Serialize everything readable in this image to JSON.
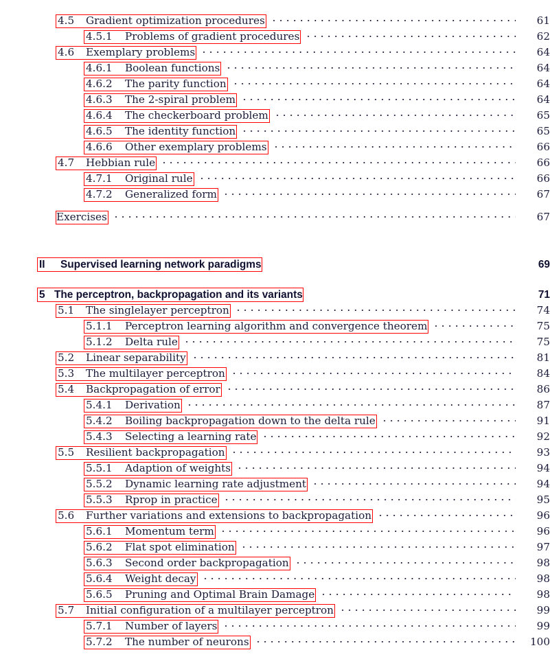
{
  "document": {
    "kind": "table-of-contents",
    "accent_color": "#ff0000",
    "text_color": "#1b1b3a"
  },
  "entries": [
    {
      "level": "section",
      "number": "4.5",
      "title": "Gradient optimization procedures",
      "page": "61"
    },
    {
      "level": "subsection",
      "number": "4.5.1",
      "title": "Problems of gradient procedures",
      "page": "62"
    },
    {
      "level": "section",
      "number": "4.6",
      "title": "Exemplary problems",
      "page": "64"
    },
    {
      "level": "subsection",
      "number": "4.6.1",
      "title": "Boolean functions",
      "page": "64"
    },
    {
      "level": "subsection",
      "number": "4.6.2",
      "title": "The parity function",
      "page": "64"
    },
    {
      "level": "subsection",
      "number": "4.6.3",
      "title": "The 2-spiral problem",
      "page": "64"
    },
    {
      "level": "subsection",
      "number": "4.6.4",
      "title": "The checkerboard problem",
      "page": "65"
    },
    {
      "level": "subsection",
      "number": "4.6.5",
      "title": "The identity function",
      "page": "65"
    },
    {
      "level": "subsection",
      "number": "4.6.6",
      "title": "Other exemplary problems",
      "page": "66"
    },
    {
      "level": "section",
      "number": "4.7",
      "title": "Hebbian rule",
      "page": "66"
    },
    {
      "level": "subsection",
      "number": "4.7.1",
      "title": "Original rule",
      "page": "66"
    },
    {
      "level": "subsection",
      "number": "4.7.2",
      "title": "Generalized form",
      "page": "67"
    },
    {
      "level": "plain",
      "number": "",
      "title": "Exercises",
      "page": "67"
    },
    {
      "level": "part",
      "number": "II",
      "title": "Supervised learning network paradigms",
      "page": "69"
    },
    {
      "level": "chapter",
      "number": "5",
      "title": "The perceptron, backpropagation and its variants",
      "page": "71"
    },
    {
      "level": "section",
      "number": "5.1",
      "title": "The singlelayer perceptron",
      "page": "74"
    },
    {
      "level": "subsection",
      "number": "5.1.1",
      "title": "Perceptron learning algorithm and convergence theorem",
      "page": "75"
    },
    {
      "level": "subsection",
      "number": "5.1.2",
      "title": "Delta rule",
      "page": "75"
    },
    {
      "level": "section",
      "number": "5.2",
      "title": "Linear separability",
      "page": "81"
    },
    {
      "level": "section",
      "number": "5.3",
      "title": "The multilayer perceptron",
      "page": "84"
    },
    {
      "level": "section",
      "number": "5.4",
      "title": "Backpropagation of error",
      "page": "86"
    },
    {
      "level": "subsection",
      "number": "5.4.1",
      "title": "Derivation",
      "page": "87"
    },
    {
      "level": "subsection",
      "number": "5.4.2",
      "title": "Boiling backpropagation down to the delta rule",
      "page": "91"
    },
    {
      "level": "subsection",
      "number": "5.4.3",
      "title": "Selecting a learning rate",
      "page": "92"
    },
    {
      "level": "section",
      "number": "5.5",
      "title": "Resilient backpropagation",
      "page": "93"
    },
    {
      "level": "subsection",
      "number": "5.5.1",
      "title": "Adaption of weights",
      "page": "94"
    },
    {
      "level": "subsection",
      "number": "5.5.2",
      "title": "Dynamic learning rate adjustment",
      "page": "94"
    },
    {
      "level": "subsection",
      "number": "5.5.3",
      "title": "Rprop in practice",
      "page": "95"
    },
    {
      "level": "section",
      "number": "5.6",
      "title": "Further variations and extensions to backpropagation",
      "page": "96"
    },
    {
      "level": "subsection",
      "number": "5.6.1",
      "title": "Momentum term",
      "page": "96"
    },
    {
      "level": "subsection",
      "number": "5.6.2",
      "title": "Flat spot elimination",
      "page": "97"
    },
    {
      "level": "subsection",
      "number": "5.6.3",
      "title": "Second order backpropagation",
      "page": "98"
    },
    {
      "level": "subsection",
      "number": "5.6.4",
      "title": "Weight decay",
      "page": "98"
    },
    {
      "level": "subsection",
      "number": "5.6.5",
      "title": "Pruning and Optimal Brain Damage",
      "page": "98"
    },
    {
      "level": "section",
      "number": "5.7",
      "title": "Initial configuration of a multilayer perceptron",
      "page": "99"
    },
    {
      "level": "subsection",
      "number": "5.7.1",
      "title": "Number of layers",
      "page": "99"
    },
    {
      "level": "subsection",
      "number": "5.7.2",
      "title": "The number of neurons",
      "page": "100"
    }
  ]
}
